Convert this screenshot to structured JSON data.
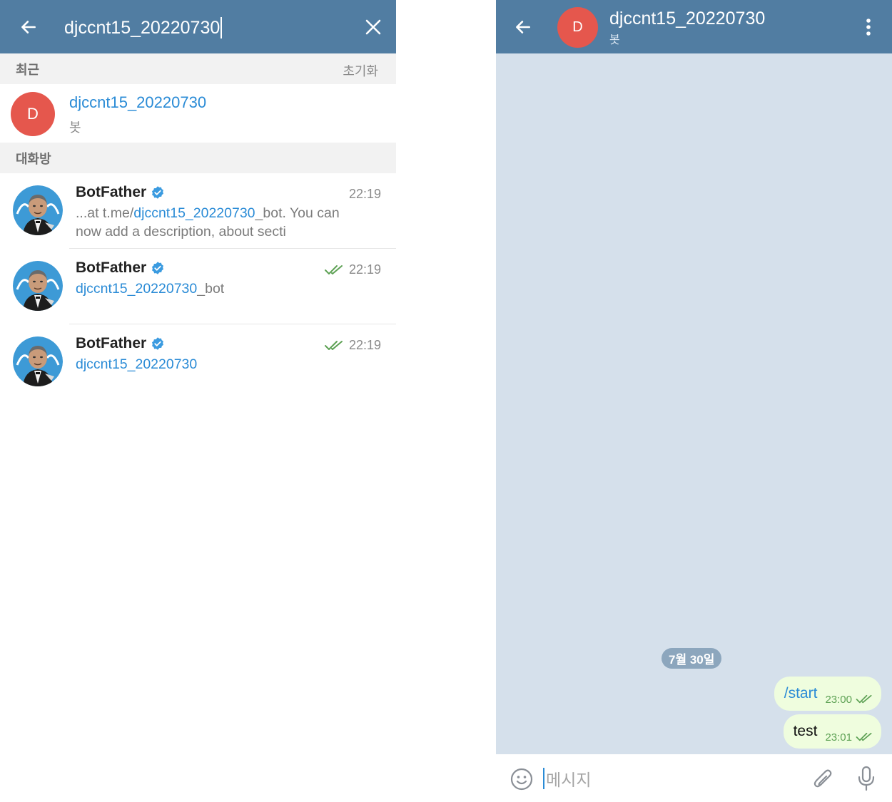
{
  "search": {
    "query": "djccnt15_20220730"
  },
  "recent": {
    "header": "최근",
    "reset_label": "초기화",
    "item": {
      "avatar_letter": "D",
      "name": "djccnt15_20220730",
      "subtitle": "봇"
    }
  },
  "chats": {
    "header": "대화방",
    "rows": [
      {
        "name": "BotFather",
        "time": "22:19",
        "read": false,
        "line1_prefix": "...at t.me/",
        "line1_hl": "djccnt15_20220730",
        "line1_suffix": "_bot. You can",
        "line2": "now add a description, about secti"
      },
      {
        "name": "BotFather",
        "time": "22:19",
        "read": true,
        "hl": "djccnt15_20220730",
        "suffix": "_bot"
      },
      {
        "name": "BotFather",
        "time": "22:19",
        "read": true,
        "hl": "djccnt15_20220730",
        "suffix": ""
      }
    ]
  },
  "chat": {
    "avatar_letter": "D",
    "title": "djccnt15_20220730",
    "subtitle": "봇",
    "date_label": "7월 30일",
    "messages": [
      {
        "text": "/start",
        "time": "23:00",
        "status": "read"
      },
      {
        "text": "test",
        "time": "23:01",
        "status": "read"
      }
    ],
    "input_placeholder": "메시지"
  },
  "icons": {
    "back": "arrow-left-icon",
    "clear": "close-icon",
    "menu": "more-vertical-icon",
    "emoji": "emoji-icon",
    "attach": "paperclip-icon",
    "mic": "microphone-icon",
    "verified": "verified-badge-icon",
    "read": "double-check-icon"
  },
  "colors": {
    "header": "#517da2",
    "chat_bg": "#d5e0eb",
    "link": "#2a8bd6",
    "avatar": "#e5574d",
    "bubble_out": "#effdde",
    "check": "#5da154",
    "date_pill": "#8ca6bd"
  }
}
